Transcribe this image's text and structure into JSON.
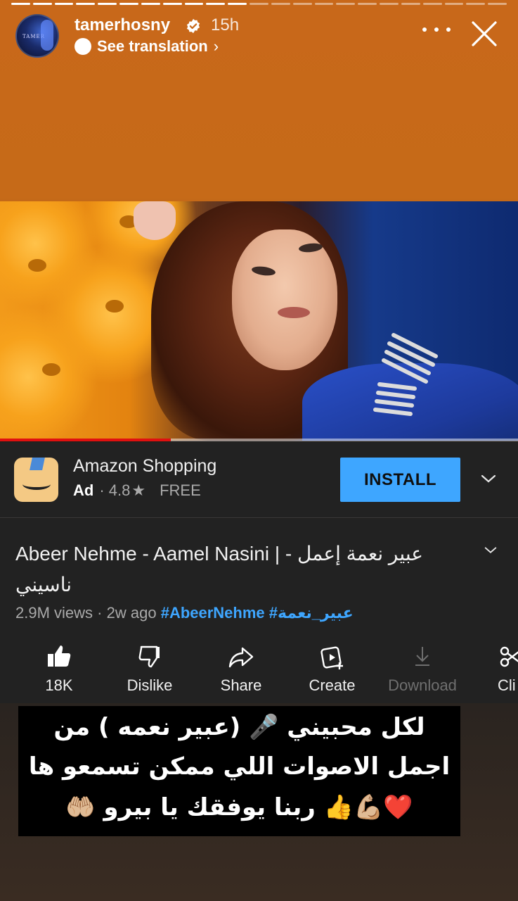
{
  "story": {
    "segments": 23,
    "segments_done": 11,
    "username": "tamerhosny",
    "time_ago": "15h",
    "see_translation": "See translation",
    "avatar_text": "TAMER"
  },
  "video": {
    "progress_fraction": 0.33
  },
  "ad": {
    "app_name": "Amazon Shopping",
    "tag": "Ad",
    "rating": "4.8",
    "star": "★",
    "price": "FREE",
    "install_label": "INSTALL"
  },
  "info": {
    "title": "Abeer Nehme - Aamel Nasini | - عبير نعمة إعمل ناسيني",
    "views": "2.9M views",
    "date": "2w ago",
    "tags": "#AbeerNehme #عبير_نعمة",
    "actions": [
      {
        "label": "18K",
        "icon": "thumbs-up-icon"
      },
      {
        "label": "Dislike",
        "icon": "thumbs-down-icon"
      },
      {
        "label": "Share",
        "icon": "share-icon"
      },
      {
        "label": "Create",
        "icon": "create-icon"
      },
      {
        "label": "Download",
        "icon": "download-icon"
      },
      {
        "label": "Cli",
        "icon": "clip-icon"
      }
    ]
  },
  "caption": {
    "line1": "لكل محبيني 🎤 (عبير نعمه ) من",
    "line2": "اجمل الاصوات اللي ممكن تسمعو ها",
    "line3": "❤️💪🏼👍 ربنا يوفقك يا بيرو 🤲🏼"
  },
  "colors": {
    "story_bg": "#c8681a",
    "install_blue": "#3ea6ff",
    "youtube_red": "#e01010",
    "panel_bg": "#222222"
  }
}
